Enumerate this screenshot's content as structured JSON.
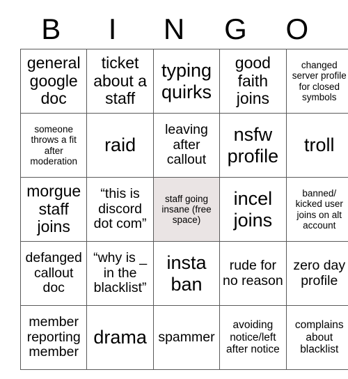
{
  "card": {
    "header_letters": [
      "B",
      "I",
      "N",
      "G",
      "O"
    ],
    "free_space_color": "#eae4e4",
    "border_color": "#5a5a5a",
    "rows": [
      [
        {
          "text": "general google doc",
          "size": "lg",
          "free": false
        },
        {
          "text": "ticket about a staff",
          "size": "lg",
          "free": false
        },
        {
          "text": "typing quirks",
          "size": "xl",
          "free": false
        },
        {
          "text": "good faith joins",
          "size": "lg",
          "free": false
        },
        {
          "text": "changed server profile for closed symbols",
          "size": "xs",
          "free": false
        }
      ],
      [
        {
          "text": "someone throws a fit after moderation",
          "size": "xs",
          "free": false
        },
        {
          "text": "raid",
          "size": "xl",
          "free": false
        },
        {
          "text": "leaving after callout",
          "size": "md",
          "free": false
        },
        {
          "text": "nsfw profile",
          "size": "xl",
          "free": false
        },
        {
          "text": "troll",
          "size": "xl",
          "free": false
        }
      ],
      [
        {
          "text": "morgue staff joins",
          "size": "lg",
          "free": false
        },
        {
          "text": "“this is discord dot com”",
          "size": "md",
          "free": false
        },
        {
          "text": "staff going insane (free space)",
          "size": "xs",
          "free": true
        },
        {
          "text": "incel joins",
          "size": "xl",
          "free": false
        },
        {
          "text": "banned/ kicked user joins on alt account",
          "size": "xs",
          "free": false
        }
      ],
      [
        {
          "text": "defanged callout doc",
          "size": "md",
          "free": false
        },
        {
          "text": "“why is _ in the blacklist”",
          "size": "md",
          "free": false
        },
        {
          "text": "insta ban",
          "size": "xl",
          "free": false
        },
        {
          "text": "rude for no reason",
          "size": "md",
          "free": false
        },
        {
          "text": "zero day profile",
          "size": "md",
          "free": false
        }
      ],
      [
        {
          "text": "member reporting member",
          "size": "md",
          "free": false
        },
        {
          "text": "drama",
          "size": "xl",
          "free": false
        },
        {
          "text": "spammer",
          "size": "md",
          "free": false
        },
        {
          "text": "avoiding notice/left after notice",
          "size": "sm",
          "free": false
        },
        {
          "text": "complains about blacklist",
          "size": "sm",
          "free": false
        }
      ]
    ]
  }
}
